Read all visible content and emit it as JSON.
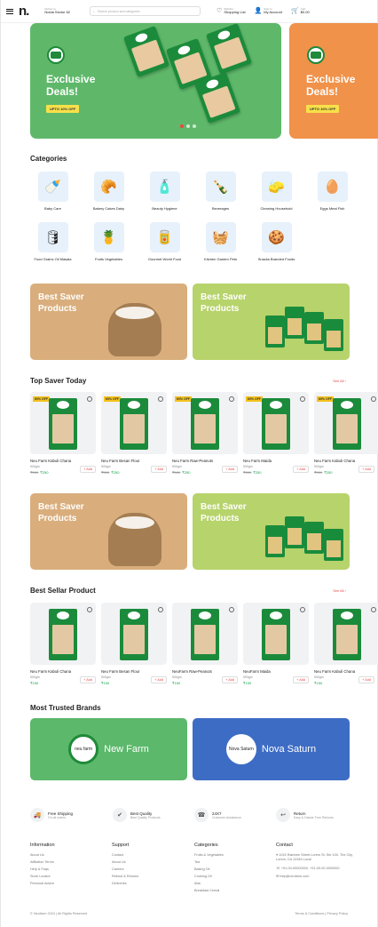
{
  "header": {
    "logo": "n.",
    "location_caption": "Deliver to",
    "location_value": "Noida Sector 62",
    "search_placeholder": "Search product and categories",
    "shopping_caption": "Wishlist",
    "shopping_label": "Shopping List",
    "account_caption": "Sign In",
    "account_label": "My Account",
    "cart_caption": "Cart",
    "cart_value": "$0.00"
  },
  "hero": {
    "title_line1": "Exclusive",
    "title_line2": "Deals!",
    "button": "UPTO 10% OFF",
    "slides": 3,
    "active_slide": 1,
    "colors": {
      "green": "#5fb86a",
      "orange": "#f0924a"
    }
  },
  "categories": {
    "title": "Categories",
    "items": [
      {
        "label": "Baby Care",
        "icon": "🍼"
      },
      {
        "label": "Bakery Cakes Dairy",
        "icon": "🥐"
      },
      {
        "label": "Beauty Hygiene",
        "icon": "🧴"
      },
      {
        "label": "Beverages",
        "icon": "🍾"
      },
      {
        "label": "Cleaning Household",
        "icon": "🧽"
      },
      {
        "label": "Eggs Meat Fish",
        "icon": "🥚"
      },
      {
        "label": "Food Grains Oil Masala",
        "icon": "🛢"
      },
      {
        "label": "Fruits Vegetables",
        "icon": "🍍"
      },
      {
        "label": "Gourmet World Food",
        "icon": "🥫"
      },
      {
        "label": "Kitchen Garden Pets",
        "icon": "🧺"
      },
      {
        "label": "Snacks Branded Foods",
        "icon": "🍪"
      }
    ]
  },
  "promo": {
    "line1": "Best  Saver",
    "line2": "Products"
  },
  "top_saver": {
    "title": "Top Saver Today",
    "see_all": "See All",
    "badge": "60% OFF",
    "items": [
      {
        "name": "Neu Farm Kabuli Chana",
        "weight": "500gm",
        "old": "₹550",
        "price": "₹250"
      },
      {
        "name": "Neu Farm Besan Flour",
        "weight": "500gm",
        "old": "₹550",
        "price": "₹250"
      },
      {
        "name": "Neu Farm Raw-Peanuts",
        "weight": "500gm",
        "old": "₹550",
        "price": "₹250"
      },
      {
        "name": "Neu Farm Maida",
        "weight": "500gm",
        "old": "₹550",
        "price": "₹250"
      },
      {
        "name": "Neu Farm Kabuli Chana",
        "weight": "500gm",
        "old": "₹550",
        "price": "₹250"
      }
    ],
    "add_label": "+ Add"
  },
  "best_seller": {
    "title": "Best Sellar Product",
    "see_all": "See All",
    "items": [
      {
        "name": "Neu Farm Kabuli Chana",
        "weight": "500gm",
        "price": "₹150"
      },
      {
        "name": "Neu Farm Besan Flour",
        "weight": "500gm",
        "price": "₹150"
      },
      {
        "name": "NeuFarm Raw-Peanuts",
        "weight": "500gm",
        "price": "₹150"
      },
      {
        "name": "NeuFarm Maida",
        "weight": "500gm",
        "price": "₹150"
      },
      {
        "name": "Neu Farm Kabuli Chana",
        "weight": "500gm",
        "price": "₹150"
      }
    ],
    "add_label": "+ Add"
  },
  "brands": {
    "title": "Most Trusted Brands",
    "items": [
      {
        "name": "New Farm",
        "badge": "neu farm",
        "color": "#5cb86b"
      },
      {
        "name": "Nova Saturn",
        "badge": "Nova Saturn",
        "color": "#3d6cc4"
      }
    ]
  },
  "features": [
    {
      "title": "Free Shipping",
      "desc": "On all orders",
      "icon": "🚚"
    },
    {
      "title": "Best Quality",
      "desc": "Best Quality Products",
      "icon": "✔"
    },
    {
      "title": "24X7",
      "desc": "Customer Assistance",
      "icon": "☎"
    },
    {
      "title": "Return",
      "desc": "Easy & Hassle Free Refunds",
      "icon": "↩"
    }
  ],
  "footer": {
    "information": {
      "title": "Information",
      "links": [
        "About Us",
        "Affiliation Terms",
        "Help & Faqs",
        "Store Locator",
        "Personal Advice"
      ]
    },
    "support": {
      "title": "Support",
      "links": [
        "Contact",
        "About Us",
        "Careers",
        "Refund & Returns",
        "Deliveries"
      ]
    },
    "categories": {
      "title": "Categories",
      "links": [
        "Fruits & Vegetables",
        "Tea",
        "Baking Oil",
        "Cooking Oil",
        "Atta",
        "Breakfast Cereal"
      ]
    },
    "contact": {
      "title": "Contact",
      "address": "1015 Raintree Street Lorem St, Ste 100, The City, Lorem, CA 12345 Local",
      "phone": "+91-00-00000000, +91-00-00-0000000",
      "email": "help@neufarm.com"
    },
    "copyright": "© Neufarm 2024 | All Rights Reserved",
    "policy": "Terms & Conditions | Privacy Policy"
  }
}
